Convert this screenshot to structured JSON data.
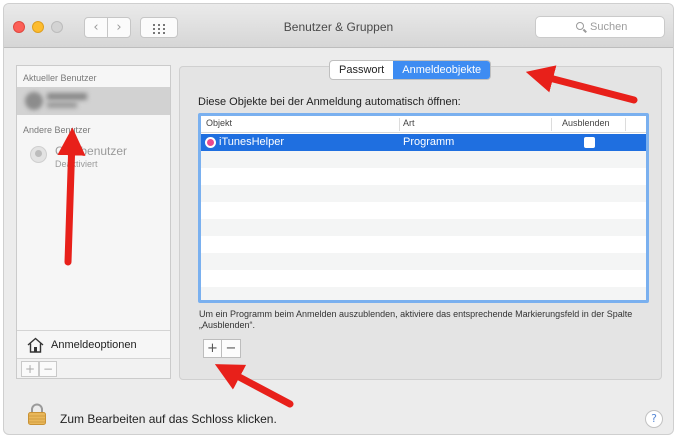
{
  "window": {
    "title": "Benutzer & Gruppen",
    "search_placeholder": "Suchen",
    "back_label": "‹",
    "forward_label": "›"
  },
  "sidebar": {
    "current_user_label": "Aktueller Benutzer",
    "other_users_label": "Andere Benutzer",
    "guest_name": "Gastbenutzer",
    "guest_status": "Deaktiviert",
    "login_options_label": "Anmeldeoptionen",
    "add_label": "+",
    "remove_label": "−"
  },
  "tabs": [
    {
      "label": "Passwort",
      "active": false
    },
    {
      "label": "Anmeldeobjekte",
      "active": true
    }
  ],
  "login_items": {
    "intro": "Diese Objekte bei der Anmeldung automatisch öffnen:",
    "columns": [
      "Objekt",
      "Art",
      "Ausblenden"
    ],
    "rows": [
      {
        "name": "iTunesHelper",
        "kind": "Programm",
        "hide": false
      }
    ],
    "help_text": "Um ein Programm beim Anmelden auszublenden, aktiviere das entsprechende Markierungsfeld in der Spalte „Ausblenden“.",
    "add_label": "+",
    "remove_label": "−"
  },
  "footer": {
    "lock_text": "Zum Bearbeiten auf das Schloss klicken.",
    "help_label": "?"
  },
  "colors": {
    "selection": "#1f6fe0",
    "tab_active": "#3e8cf2",
    "annotation_arrow": "#e8201a"
  }
}
